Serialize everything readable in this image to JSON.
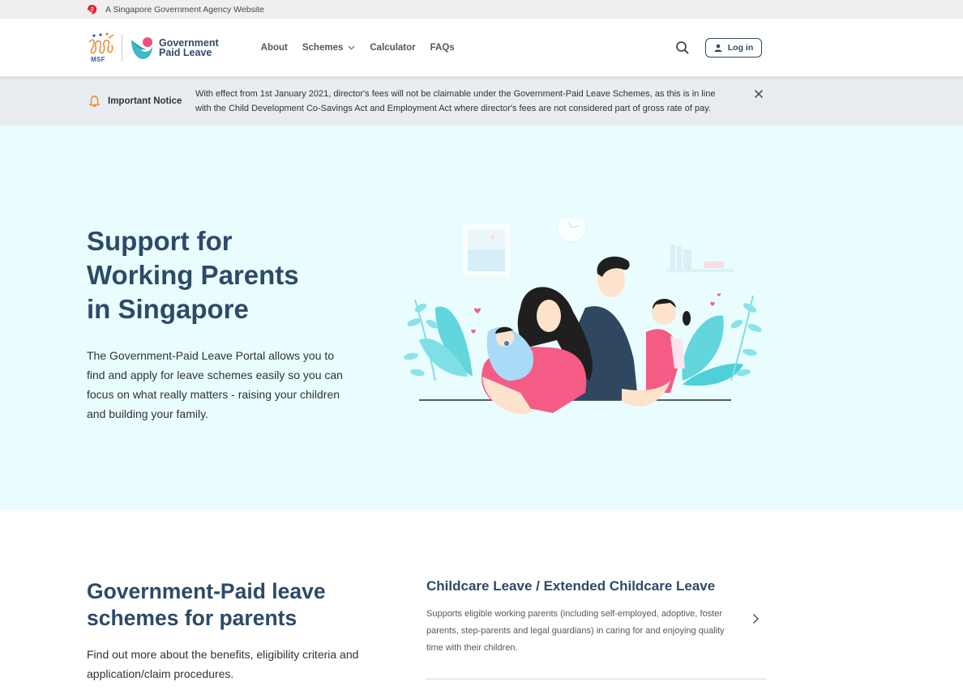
{
  "masthead": {
    "text": "A Singapore Government Agency Website"
  },
  "header": {
    "msf_logo_text": "MSF",
    "brand_line1": "Government",
    "brand_line2": "Paid Leave",
    "nav": [
      {
        "label": "About"
      },
      {
        "label": "Schemes",
        "has_dropdown": true
      },
      {
        "label": "Calculator"
      },
      {
        "label": "FAQs"
      }
    ],
    "login_label": "Log in"
  },
  "notice": {
    "title": "Important Notice",
    "message": "With effect from 1st January 2021, director's fees will not be claimable under the Government-Paid Leave Schemes, as this is in line with the Child Development Co-Savings Act and Employment Act where director's fees are not considered part of gross rate of pay."
  },
  "hero": {
    "title_lines": [
      "Support for",
      "Working Parents",
      "in Singapore"
    ],
    "description": "The Government-Paid Leave Portal allows you to find and apply for leave schemes easily so you can focus on what really matters - raising your children and building your family."
  },
  "schemes": {
    "title_lines": [
      "Government-Paid leave",
      "schemes for parents"
    ],
    "description": "Find out more about the benefits, eligibility criteria and application/claim procedures.",
    "items": [
      {
        "title": "Childcare Leave / Extended Childcare Leave",
        "description": "Supports eligible working parents (including self-employed, adoptive, foster parents, step-parents and legal guardians) in caring for and enjoying quality time with their children."
      }
    ]
  },
  "colors": {
    "primary_text": "#2d4a67",
    "hero_bg": "#e9fdfe",
    "notice_bg": "#e9ecf0",
    "masthead_bg": "#efefef",
    "accent_orange": "#e58a2c",
    "accent_red": "#d8232a"
  }
}
